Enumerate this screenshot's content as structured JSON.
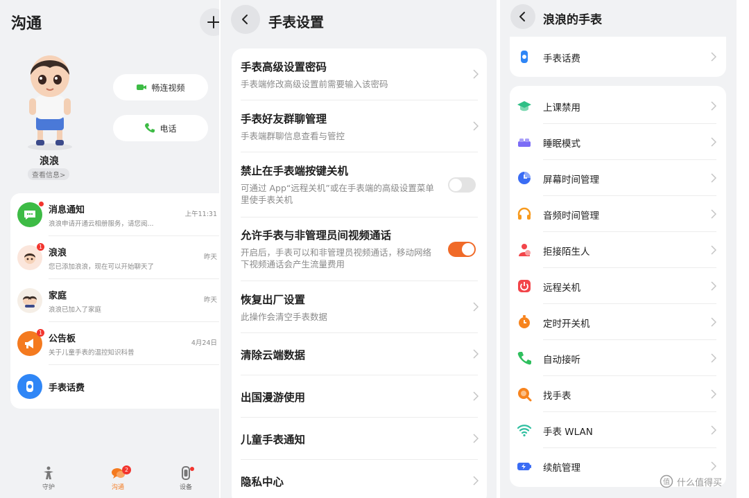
{
  "panel1": {
    "title": "沟通",
    "profile": {
      "name": "浪浪",
      "info_link": "查看信息>"
    },
    "buttons": {
      "video": "畅连视频",
      "call": "电话"
    },
    "messages": [
      {
        "title": "消息通知",
        "subtitle": "浪浪申请开通云相册服务，请您阅...",
        "time": "上午11:31",
        "badge": "",
        "icon": "message-icon",
        "color": "#3dbb45"
      },
      {
        "title": "浪浪",
        "subtitle": "您已添加浪浪，现在可以开始聊天了",
        "time": "昨天",
        "badge": "1",
        "icon": "child-avatar-icon",
        "color": "#fbe6dc"
      },
      {
        "title": "家庭",
        "subtitle": "浪浪已加入了家庭",
        "time": "昨天",
        "badge": "",
        "icon": "family-avatar-icon",
        "color": "#f5eee6"
      },
      {
        "title": "公告板",
        "subtitle": "关于儿童手表的温控知识科普",
        "time": "4月24日",
        "badge": "1",
        "icon": "megaphone-icon",
        "color": "#f47a1f"
      },
      {
        "title": "手表话费",
        "subtitle": "",
        "time": "",
        "badge": "",
        "icon": "watch-credit-icon",
        "color": "#2f86f6"
      }
    ],
    "nav": [
      {
        "label": "守护",
        "icon": "guard-icon",
        "badge": ""
      },
      {
        "label": "沟通",
        "icon": "chat-icon",
        "badge": "2"
      },
      {
        "label": "设备",
        "icon": "watch-device-icon",
        "badge": "dot"
      }
    ],
    "accent": "#f47a1f"
  },
  "panel2": {
    "title": "手表设置",
    "settings": [
      {
        "title": "手表高级设置密码",
        "desc": "手表端修改高级设置前需要输入该密码",
        "control": "chevron"
      },
      {
        "title": "手表好友群聊管理",
        "desc": "手表端群聊信息查看与管控",
        "control": "chevron"
      },
      {
        "title": "禁止在手表端按键关机",
        "desc": "可通过 App“远程关机”或在手表端的高级设置菜单里使手表关机",
        "control": "toggle",
        "on": false
      },
      {
        "title": "允许手表与非管理员间视频通话",
        "desc": "开启后，手表可以和非管理员视频通话，移动网络下视频通话会产生流量费用",
        "control": "toggle",
        "on": true
      },
      {
        "title": "恢复出厂设置",
        "desc": "此操作会清空手表数据",
        "control": "chevron"
      },
      {
        "title": "清除云端数据",
        "desc": "",
        "control": "chevron"
      },
      {
        "title": "出国漫游使用",
        "desc": "",
        "control": "chevron"
      },
      {
        "title": "儿童手表通知",
        "desc": "",
        "control": "chevron"
      },
      {
        "title": "隐私中心",
        "desc": "",
        "control": "chevron"
      }
    ],
    "toggle_on_color": "#f06a28",
    "toggle_off_color": "#e3e3e3"
  },
  "panel3": {
    "title": "浪浪的手表",
    "top_item": {
      "label": "手表话费",
      "icon": "watch-credit-icon",
      "color": "#2f86f6"
    },
    "items": [
      {
        "label": "上课禁用",
        "icon": "graduation-cap-icon",
        "color": "#2fbf86"
      },
      {
        "label": "睡眠模式",
        "icon": "sleep-mode-icon",
        "color": "#7b6cf6"
      },
      {
        "label": "屏幕时间管理",
        "icon": "screen-time-icon",
        "color": "#3a6cf4"
      },
      {
        "label": "音频时间管理",
        "icon": "headphones-icon",
        "color": "#f79a1e"
      },
      {
        "label": "拒接陌生人",
        "icon": "block-stranger-icon",
        "color": "#f2454a"
      },
      {
        "label": "远程关机",
        "icon": "power-icon",
        "color": "#f2454a"
      },
      {
        "label": "定时开关机",
        "icon": "timer-icon",
        "color": "#f7841e"
      },
      {
        "label": "自动接听",
        "icon": "phone-icon",
        "color": "#2fbf5e"
      },
      {
        "label": "找手表",
        "icon": "find-watch-icon",
        "color": "#f7841e"
      },
      {
        "label": "手表 WLAN",
        "icon": "wifi-icon",
        "color": "#2fbfa0"
      },
      {
        "label": "续航管理",
        "icon": "battery-icon",
        "color": "#3a6cf4"
      }
    ]
  },
  "watermark": "什么值得买"
}
